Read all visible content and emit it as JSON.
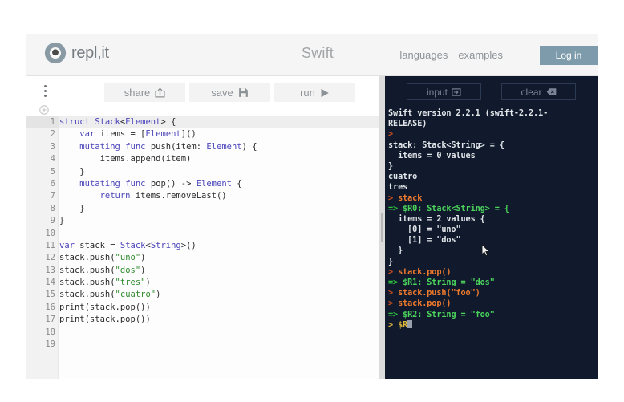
{
  "header": {
    "logo_text": "repl,it",
    "logo_icon": "repl-aperture-logo-icon",
    "language_title": "Swift",
    "nav": [
      {
        "label": "languages",
        "name": "nav-link-languages"
      },
      {
        "label": "examples",
        "name": "nav-link-examples"
      }
    ],
    "login_label": "Log in"
  },
  "toolbar": {
    "menu_icon": "kebab-menu-icon",
    "add_icon": "plus-circle-icon",
    "share_label": "share",
    "share_icon": "share-export-icon",
    "save_label": "save",
    "save_icon": "floppy-disk-icon",
    "run_label": "run",
    "run_icon": "play-triangle-icon"
  },
  "editor": {
    "active_line": 1,
    "lines": [
      {
        "n": "1",
        "fold": true,
        "tokens": [
          {
            "t": "kw",
            "v": "struct"
          },
          {
            "t": "pln",
            "v": " "
          },
          {
            "t": "typ",
            "v": "Stack"
          },
          {
            "t": "pln",
            "v": "<"
          },
          {
            "t": "typ",
            "v": "Element"
          },
          {
            "t": "pln",
            "v": "> {"
          }
        ]
      },
      {
        "n": "2",
        "fold": false,
        "tokens": [
          {
            "t": "pln",
            "v": "    "
          },
          {
            "t": "kw",
            "v": "var"
          },
          {
            "t": "pln",
            "v": " items = ["
          },
          {
            "t": "typ",
            "v": "Element"
          },
          {
            "t": "pln",
            "v": "]()"
          }
        ]
      },
      {
        "n": "3",
        "fold": true,
        "tokens": [
          {
            "t": "pln",
            "v": "    "
          },
          {
            "t": "kw",
            "v": "mutating"
          },
          {
            "t": "pln",
            "v": " "
          },
          {
            "t": "kw",
            "v": "func"
          },
          {
            "t": "pln",
            "v": " push(item: "
          },
          {
            "t": "typ",
            "v": "Element"
          },
          {
            "t": "pln",
            "v": ") {"
          }
        ]
      },
      {
        "n": "4",
        "fold": false,
        "tokens": [
          {
            "t": "pln",
            "v": "        items.append(item)"
          }
        ]
      },
      {
        "n": "5",
        "fold": false,
        "tokens": [
          {
            "t": "pln",
            "v": "    }"
          }
        ]
      },
      {
        "n": "6",
        "fold": true,
        "tokens": [
          {
            "t": "pln",
            "v": "    "
          },
          {
            "t": "kw",
            "v": "mutating"
          },
          {
            "t": "pln",
            "v": " "
          },
          {
            "t": "kw",
            "v": "func"
          },
          {
            "t": "pln",
            "v": " pop() -> "
          },
          {
            "t": "typ",
            "v": "Element"
          },
          {
            "t": "pln",
            "v": " {"
          }
        ]
      },
      {
        "n": "7",
        "fold": false,
        "tokens": [
          {
            "t": "pln",
            "v": "        "
          },
          {
            "t": "kw",
            "v": "return"
          },
          {
            "t": "pln",
            "v": " items.removeLast()"
          }
        ]
      },
      {
        "n": "8",
        "fold": false,
        "tokens": [
          {
            "t": "pln",
            "v": "    }"
          }
        ]
      },
      {
        "n": "9",
        "fold": false,
        "tokens": [
          {
            "t": "pln",
            "v": "}"
          }
        ]
      },
      {
        "n": "10",
        "fold": false,
        "tokens": [
          {
            "t": "pln",
            "v": ""
          }
        ]
      },
      {
        "n": "11",
        "fold": false,
        "tokens": [
          {
            "t": "kw",
            "v": "var"
          },
          {
            "t": "pln",
            "v": " stack = "
          },
          {
            "t": "typ",
            "v": "Stack"
          },
          {
            "t": "pln",
            "v": "<"
          },
          {
            "t": "typ",
            "v": "String"
          },
          {
            "t": "pln",
            "v": ">()"
          }
        ]
      },
      {
        "n": "12",
        "fold": false,
        "tokens": [
          {
            "t": "pln",
            "v": "stack.push("
          },
          {
            "t": "str",
            "v": "\"uno\""
          },
          {
            "t": "pln",
            "v": ")"
          }
        ]
      },
      {
        "n": "13",
        "fold": false,
        "tokens": [
          {
            "t": "pln",
            "v": "stack.push("
          },
          {
            "t": "str",
            "v": "\"dos\""
          },
          {
            "t": "pln",
            "v": ")"
          }
        ]
      },
      {
        "n": "14",
        "fold": false,
        "tokens": [
          {
            "t": "pln",
            "v": "stack.push("
          },
          {
            "t": "str",
            "v": "\"tres\""
          },
          {
            "t": "pln",
            "v": ")"
          }
        ]
      },
      {
        "n": "15",
        "fold": false,
        "tokens": [
          {
            "t": "pln",
            "v": "stack.push("
          },
          {
            "t": "str",
            "v": "\"cuatro\""
          },
          {
            "t": "pln",
            "v": ")"
          }
        ]
      },
      {
        "n": "16",
        "fold": false,
        "tokens": [
          {
            "t": "pln",
            "v": "print(stack.pop())"
          }
        ]
      },
      {
        "n": "17",
        "fold": false,
        "tokens": [
          {
            "t": "pln",
            "v": "print(stack.pop())"
          }
        ]
      },
      {
        "n": "18",
        "fold": false,
        "tokens": [
          {
            "t": "pln",
            "v": ""
          }
        ]
      },
      {
        "n": "19",
        "fold": false,
        "tokens": [
          {
            "t": "pln",
            "v": ""
          }
        ]
      }
    ]
  },
  "console": {
    "input_label": "input",
    "input_icon": "input-arrow-box-icon",
    "clear_label": "clear",
    "clear_icon": "backspace-delete-icon",
    "cursor_icon": "mouse-pointer-icon",
    "lines": [
      {
        "segs": [
          {
            "c": "c-out",
            "v": "Swift version 2.2.1 (swift-2.2.1-"
          }
        ]
      },
      {
        "segs": [
          {
            "c": "c-out",
            "v": "RELEASE)"
          }
        ]
      },
      {
        "segs": [
          {
            "c": "c-prompt",
            "v": ">"
          }
        ]
      },
      {
        "segs": [
          {
            "c": "c-out",
            "v": "stack: Stack<String> = {"
          }
        ]
      },
      {
        "segs": [
          {
            "c": "c-out",
            "v": "  items = 0 values"
          }
        ]
      },
      {
        "segs": [
          {
            "c": "c-out",
            "v": "}"
          }
        ]
      },
      {
        "segs": [
          {
            "c": "c-out",
            "v": "cuatro"
          }
        ]
      },
      {
        "segs": [
          {
            "c": "c-out",
            "v": "tres"
          }
        ]
      },
      {
        "segs": [
          {
            "c": "c-prompt",
            "v": "> "
          },
          {
            "c": "c-cmd",
            "v": "stack"
          }
        ]
      },
      {
        "segs": [
          {
            "c": "c-arrow",
            "v": "=> "
          },
          {
            "c": "c-res",
            "v": "$R0: Stack<String> = {"
          }
        ]
      },
      {
        "segs": [
          {
            "c": "c-out",
            "v": "  items = 2 values {"
          }
        ]
      },
      {
        "segs": [
          {
            "c": "c-out",
            "v": "    [0] = \"uno\""
          }
        ]
      },
      {
        "segs": [
          {
            "c": "c-out",
            "v": "    [1] = \"dos\""
          }
        ]
      },
      {
        "segs": [
          {
            "c": "c-out",
            "v": "  }"
          }
        ]
      },
      {
        "segs": [
          {
            "c": "c-out",
            "v": "}"
          }
        ]
      },
      {
        "segs": [
          {
            "c": "c-prompt",
            "v": "> "
          },
          {
            "c": "c-cmd",
            "v": "stack.pop()"
          }
        ]
      },
      {
        "segs": [
          {
            "c": "c-arrow",
            "v": "=> "
          },
          {
            "c": "c-res",
            "v": "$R1: String = \"dos\""
          }
        ]
      },
      {
        "segs": [
          {
            "c": "c-prompt",
            "v": "> "
          },
          {
            "c": "c-cmd",
            "v": "stack.push(\"foo\")"
          }
        ]
      },
      {
        "segs": [
          {
            "c": "c-prompt",
            "v": "> "
          },
          {
            "c": "c-cmd",
            "v": "stack.pop()"
          }
        ]
      },
      {
        "segs": [
          {
            "c": "c-arrow",
            "v": "=> "
          },
          {
            "c": "c-res",
            "v": "$R2: String = \"foo\""
          }
        ]
      },
      {
        "segs": [
          {
            "c": "c-yellow",
            "v": "> "
          },
          {
            "c": "c-yellow",
            "v": "$R"
          }
        ],
        "cursor": true
      }
    ]
  }
}
